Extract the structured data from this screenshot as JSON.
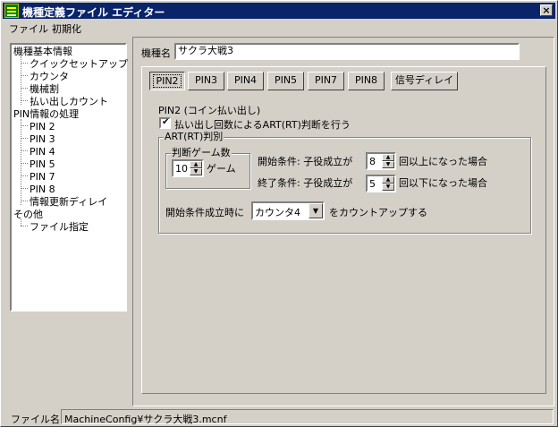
{
  "window": {
    "title": "機種定義ファイル エディター",
    "close_glyph": "×"
  },
  "menu": [
    "ファイル",
    "初期化"
  ],
  "tree": {
    "items": [
      {
        "label": "機種基本情報",
        "level": 0
      },
      {
        "label": "クイックセットアップ",
        "level": 1
      },
      {
        "label": "カウンタ",
        "level": 1
      },
      {
        "label": "機械割",
        "level": 1
      },
      {
        "label": "払い出しカウント",
        "level": 1
      },
      {
        "label": "PIN情報の処理",
        "level": 0
      },
      {
        "label": "PIN 2",
        "level": 1
      },
      {
        "label": "PIN 3",
        "level": 1
      },
      {
        "label": "PIN 4",
        "level": 1
      },
      {
        "label": "PIN 5",
        "level": 1
      },
      {
        "label": "PIN 7",
        "level": 1
      },
      {
        "label": "PIN 8",
        "level": 1
      },
      {
        "label": "情報更新ディレイ",
        "level": 1
      },
      {
        "label": "その他",
        "level": 0
      },
      {
        "label": "ファイル指定",
        "level": 1
      }
    ]
  },
  "machine": {
    "label": "機種名",
    "value": "サクラ大戦3"
  },
  "tabs": [
    "PIN2",
    "PIN3",
    "PIN4",
    "PIN5",
    "PIN7",
    "PIN8",
    "信号ディレイ"
  ],
  "active_tab": "PIN2",
  "pin2": {
    "heading": "PIN2 (コイン払い出し)",
    "checkbox_label": "払い出し回数によるART(RT)判断を行う",
    "checkbox_checked": true,
    "group_title": "ART(RT)判別",
    "games_group_title": "判断ゲーム数",
    "games_value": "10",
    "games_unit": "ゲーム",
    "start_label": "開始条件: 子役成立が",
    "start_value": "8",
    "start_suffix": "回以上になった場合",
    "end_label": "終了条件: 子役成立が",
    "end_value": "5",
    "end_suffix": "回以下になった場合",
    "on_start_label": "開始条件成立時に",
    "counter_value": "カウンタ4",
    "counter_suffix": "をカウントアップする"
  },
  "status": {
    "label": "ファイル名",
    "value": "MachineConfig¥サクラ大戦3.mcnf"
  },
  "icons": {
    "app": "machine-app-icon",
    "check": "✔",
    "spin_up": "▲",
    "spin_down": "▼",
    "combo_down": "▼"
  }
}
